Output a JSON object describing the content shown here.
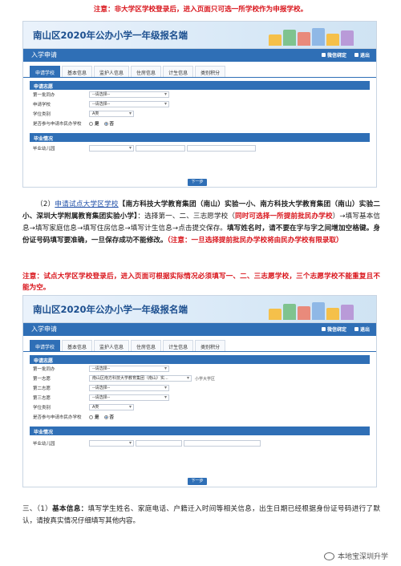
{
  "note_top": "注意：非大学区学校登录后，进入页面只可选一所学校作为申报学校。",
  "portal": {
    "banner_title": "南山区2020年公办小学一年级报名端",
    "nav_title": "入学申请",
    "nav_wechat": "微信绑定",
    "nav_logout": "退出",
    "tabs": [
      "申请学校",
      "基本信息",
      "监护人信息",
      "住房信息",
      "计生信息",
      "类别积分"
    ],
    "section_apply": "申请志愿",
    "section_grad": "毕业情况",
    "next_button": "下一步",
    "radio_yes": "是",
    "radio_no": "否",
    "select_placeholder": "--请选择--"
  },
  "shot1": {
    "rows": [
      {
        "label": "第一批同办",
        "value": "--请选择--"
      },
      {
        "label": "申请学校",
        "value": "--请选择--"
      },
      {
        "label": "学位类别",
        "value": "A类"
      },
      {
        "label": "是否参与申请市民办学校",
        "value": ""
      }
    ],
    "grad_label": "毕业幼儿园"
  },
  "shot2": {
    "rows": [
      {
        "label": "第一批同办",
        "value": "--请选择--"
      },
      {
        "label": "第一志愿",
        "value": "南山区南方科技大学教育集团（南山）实...",
        "suffix": "小学大学区"
      },
      {
        "label": "第二志愿",
        "value": "--请选择--"
      },
      {
        "label": "第三志愿",
        "value": "--请选择--"
      },
      {
        "label": "学位类别",
        "value": "A类"
      },
      {
        "label": "是否参与申请市民办学校",
        "value": ""
      }
    ],
    "grad_label": "毕业幼儿园"
  },
  "para2": {
    "num": "（2）",
    "link": "申请试点大学区学校",
    "schools": "【南方科技大学教育集团（南山）实验一小、南方科技大学教育集团（南山）实验二小、深圳大学附属教育集团实验小学】",
    "text1": "：选择第一、二、三志愿学校（",
    "red1": "同时可选择一所提前批民办学校",
    "text2": "）→填写基本信息→填写家庭信息→填写住房信息→填写计生信息→点击提交保存。",
    "bold1": "填写姓名时，请不要在字与字之间增加空格键。身份证号码填写要准确，一旦保存成功不能修改。",
    "red2": "（注意：一旦选择提前批民办学校将由民办学校有限录取）"
  },
  "note_mid": "注意：试点大学区学校登录后，进入页面可根据实际情况必须填写一、二、三志愿学校，三个志愿学校不能重复且不能为空。",
  "para3": {
    "num": "三、（1）",
    "bold": "基本信息：",
    "text": "填写学生姓名、家庭电话、户籍迁入时间等相关信息，出生日期已经根据身份证号码进行了默认，请按真实情况仔细填写其他内容。"
  },
  "watermark": "本地宝深圳升学",
  "colors": {
    "primary": "#2f6fb6",
    "note_red": "#d9141b",
    "banner_title": "#1c4f8f"
  }
}
